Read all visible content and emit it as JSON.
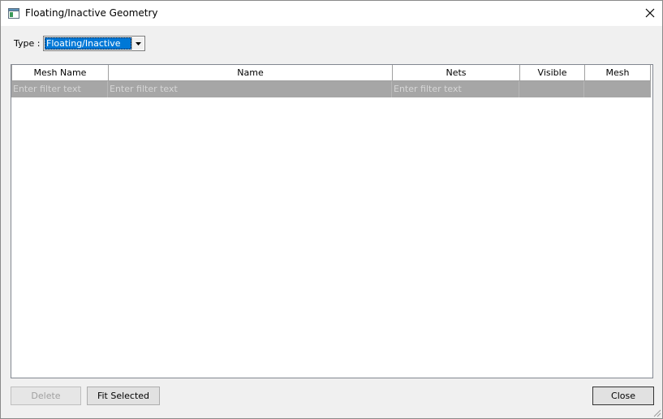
{
  "window": {
    "title": "Floating/Inactive Geometry",
    "close_glyph": "✕"
  },
  "type_filter": {
    "label": "Type :",
    "selected": "Floating/Inactive"
  },
  "table": {
    "columns": [
      "Mesh Name",
      "Name",
      "Nets",
      "Visible",
      "Mesh"
    ],
    "filter_placeholder": "Enter filter text",
    "rows": []
  },
  "buttons": {
    "delete": "Delete",
    "fit_selected": "Fit Selected",
    "close": "Close"
  },
  "colors": {
    "selection": "#0078d7",
    "filter_row": "#a6a6a6"
  }
}
